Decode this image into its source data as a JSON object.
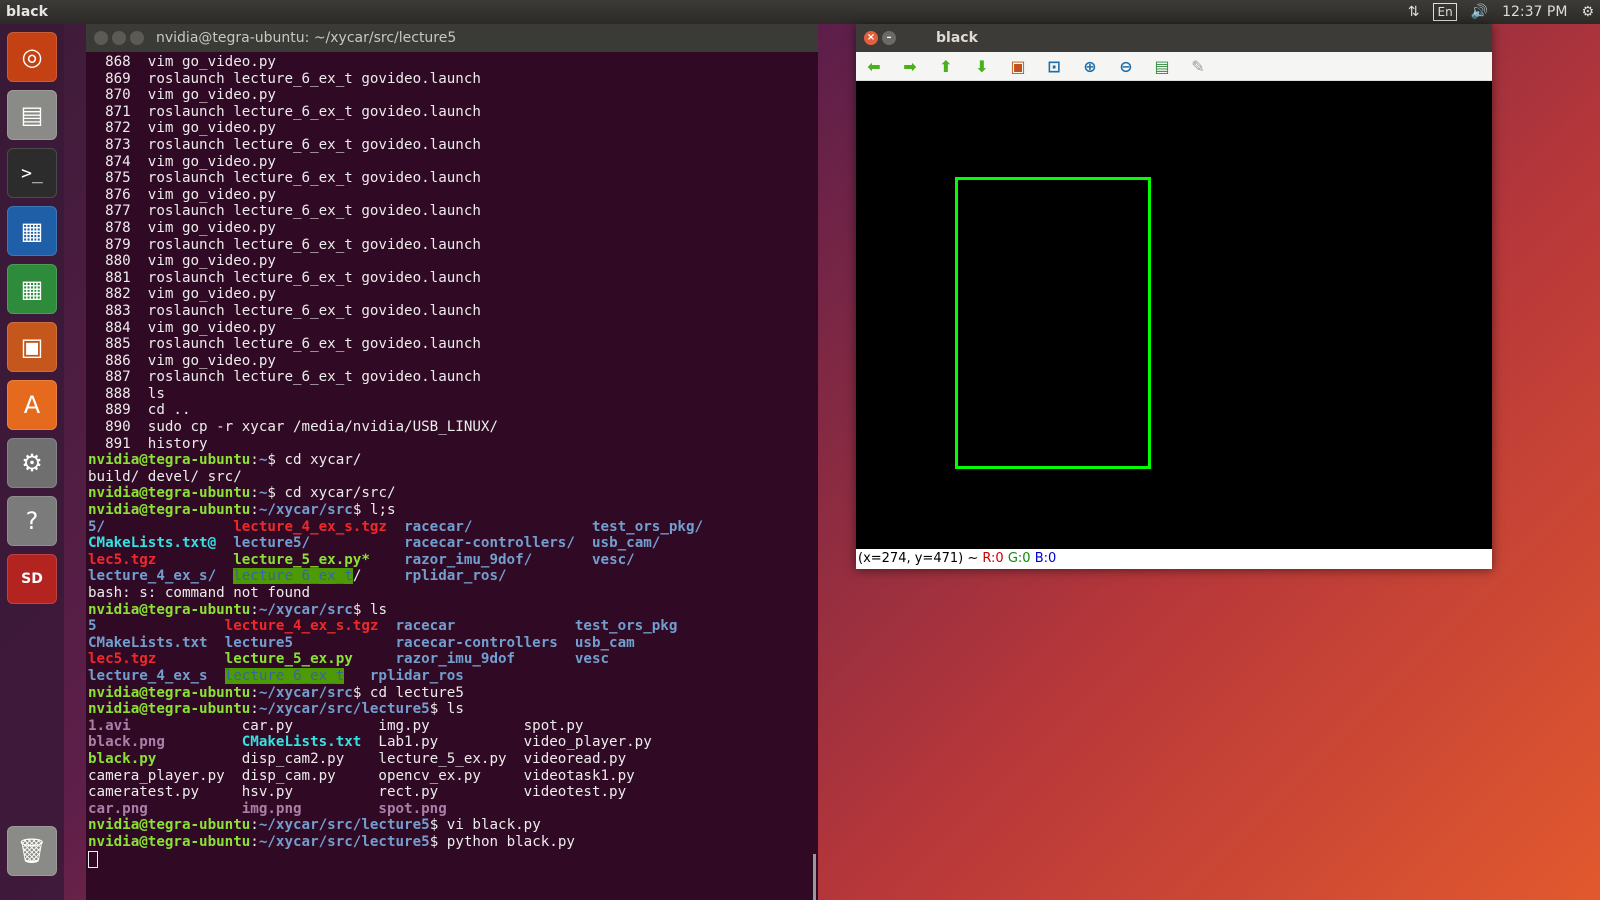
{
  "top_panel": {
    "title": "black",
    "keyboard": "En",
    "clock": "12:37 PM"
  },
  "launcher": {
    "items": [
      {
        "name": "ubuntu-dash",
        "icon": "ubuntu-logo-icon",
        "color": "#c34113"
      },
      {
        "name": "files",
        "icon": "file-cabinet-icon",
        "color": "#8a8a86"
      },
      {
        "name": "terminal",
        "icon": "terminal-icon",
        "color": "#2c2c2c"
      },
      {
        "name": "writer",
        "icon": "document-icon",
        "color": "#1f5fa8"
      },
      {
        "name": "calc",
        "icon": "spreadsheet-icon",
        "color": "#2e8b3c"
      },
      {
        "name": "impress",
        "icon": "presentation-icon",
        "color": "#c5561c"
      },
      {
        "name": "software",
        "icon": "shopping-bag-icon",
        "color": "#e66a1e"
      },
      {
        "name": "settings",
        "icon": "wrench-gear-icon",
        "color": "#6f6f6f"
      },
      {
        "name": "help",
        "icon": "question-icon",
        "color": "#7b7b7b"
      },
      {
        "name": "sd-card",
        "icon": "sd-card-icon",
        "color": "#b3231f"
      },
      {
        "name": "trash",
        "icon": "trash-icon",
        "color": "#8a8a86"
      }
    ]
  },
  "terminal": {
    "title": "nvidia@tegra-ubuntu: ~/xycar/src/lecture5",
    "history": [
      {
        "n": "868",
        "cmd": "vim go_video.py"
      },
      {
        "n": "869",
        "cmd": "roslaunch lecture_6_ex_t govideo.launch"
      },
      {
        "n": "870",
        "cmd": "vim go_video.py"
      },
      {
        "n": "871",
        "cmd": "roslaunch lecture_6_ex_t govideo.launch"
      },
      {
        "n": "872",
        "cmd": "vim go_video.py"
      },
      {
        "n": "873",
        "cmd": "roslaunch lecture_6_ex_t govideo.launch"
      },
      {
        "n": "874",
        "cmd": "vim go_video.py"
      },
      {
        "n": "875",
        "cmd": "roslaunch lecture_6_ex_t govideo.launch"
      },
      {
        "n": "876",
        "cmd": "vim go_video.py"
      },
      {
        "n": "877",
        "cmd": "roslaunch lecture_6_ex_t govideo.launch"
      },
      {
        "n": "878",
        "cmd": "vim go_video.py"
      },
      {
        "n": "879",
        "cmd": "roslaunch lecture_6_ex_t govideo.launch"
      },
      {
        "n": "880",
        "cmd": "vim go_video.py"
      },
      {
        "n": "881",
        "cmd": "roslaunch lecture_6_ex_t govideo.launch"
      },
      {
        "n": "882",
        "cmd": "vim go_video.py"
      },
      {
        "n": "883",
        "cmd": "roslaunch lecture_6_ex_t govideo.launch"
      },
      {
        "n": "884",
        "cmd": "vim go_video.py"
      },
      {
        "n": "885",
        "cmd": "roslaunch lecture_6_ex_t govideo.launch"
      },
      {
        "n": "886",
        "cmd": "vim go_video.py"
      },
      {
        "n": "887",
        "cmd": "roslaunch lecture_6_ex_t govideo.launch"
      },
      {
        "n": "888",
        "cmd": "ls"
      },
      {
        "n": "889",
        "cmd": "cd .."
      },
      {
        "n": "890",
        "cmd": "sudo cp -r xycar /media/nvidia/USB_LINUX/"
      },
      {
        "n": "891",
        "cmd": "history"
      }
    ],
    "prompt_user": "nvidia@tegra-ubuntu",
    "session": {
      "p1": {
        "path": "~",
        "cmd": "cd xycar/"
      },
      "out1": "build/ devel/ src/",
      "p2": {
        "path": "~",
        "cmd": "cd xycar/src/"
      },
      "p3": {
        "path": "~/xycar/src",
        "cmd": "l;s"
      },
      "ls1": [
        [
          "5/",
          "lecture_4_ex_s.tgz",
          "racecar/",
          "test_ors_pkg/"
        ],
        [
          "CMakeLists.txt@",
          "lecture5/",
          "racecar-controllers/",
          "usb_cam/"
        ],
        [
          "lec5.tgz",
          "lecture_5_ex.py*",
          "razor_imu_9dof/",
          "vesc/"
        ],
        [
          "lecture_4_ex_s/",
          "lecture_6_ex_t",
          "/",
          "rplidar_ros/"
        ]
      ],
      "err": "bash: s: command not found",
      "p4": {
        "path": "~/xycar/src",
        "cmd": "ls"
      },
      "ls2": [
        [
          "5",
          "lecture_4_ex_s.tgz",
          "racecar",
          "test_ors_pkg"
        ],
        [
          "CMakeLists.txt",
          "lecture5",
          "racecar-controllers",
          "usb_cam"
        ],
        [
          "lec5.tgz",
          "lecture_5_ex.py",
          "razor_imu_9dof",
          "vesc"
        ],
        [
          "lecture_4_ex_s",
          "lecture_6_ex_t",
          "rplidar_ros",
          ""
        ]
      ],
      "p5": {
        "path": "~/xycar/src",
        "cmd": "cd lecture5"
      },
      "p6": {
        "path": "~/xycar/src/lecture5",
        "cmd": "ls"
      },
      "ls3": [
        [
          "1.avi",
          "car.py",
          "img.py",
          "spot.py"
        ],
        [
          "black.png",
          "CMakeLists.txt",
          "Lab1.py",
          "video_player.py"
        ],
        [
          "black.py",
          "disp_cam2.py",
          "lecture_5_ex.py",
          "videoread.py"
        ],
        [
          "camera_player.py",
          "disp_cam.py",
          "opencv_ex.py",
          "videotask1.py"
        ],
        [
          "cameratest.py",
          "hsv.py",
          "rect.py",
          "videotest.py"
        ],
        [
          "car.png",
          "img.png",
          "spot.png",
          ""
        ]
      ],
      "p7": {
        "path": "~/xycar/src/lecture5",
        "cmd": "vi black.py"
      },
      "p8": {
        "path": "~/xycar/src/lecture5",
        "cmd": "python black.py"
      }
    }
  },
  "image_window": {
    "title": "black",
    "toolbar": [
      "arrow-left-icon",
      "arrow-right-icon",
      "arrow-up-icon",
      "arrow-down-icon",
      "image-icon",
      "zoom-fit-icon",
      "zoom-in-icon",
      "zoom-out-icon",
      "save-icon",
      "properties-icon"
    ],
    "status_xy": "(x=274, y=471) ~",
    "status_r": "R:0",
    "status_g": "G:0",
    "status_b": "B:0",
    "rect_color": "#00ff00"
  }
}
